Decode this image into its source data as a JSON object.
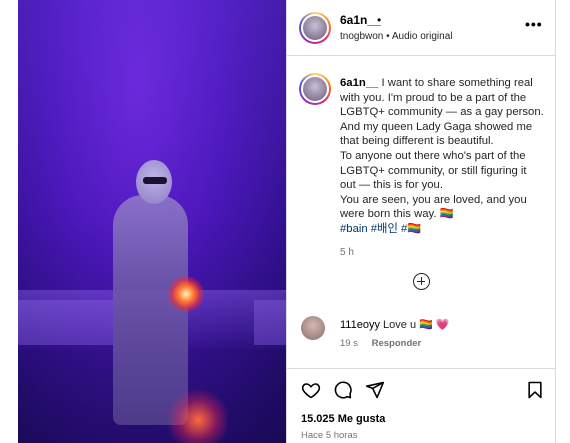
{
  "post": {
    "username": "6a1n__",
    "separator_dot": "•",
    "audio_line": "tnogbwon • Audio original",
    "more_label": "•••",
    "caption_username": "6a1n__",
    "caption_lines": [
      "I want to share something real",
      "with you. I'm proud to be a part of the",
      "LGBTQ+ community — as a gay person.",
      "And my queen Lady Gaga showed me",
      "that being different is beautiful.",
      "To anyone out there who's part of the",
      "LGBTQ+ community, or still figuring it",
      "out — this is for you.",
      "You are seen, you are loved, and you",
      "were born this way. 🏳️‍🌈"
    ],
    "hashtags": "#bain #배인 #🏳️‍🌈",
    "caption_time": "5 h"
  },
  "comment": {
    "username": "111eoyy",
    "text": "Love u 🏳️‍🌈 💗",
    "time": "19 s",
    "reply_label": "Responder"
  },
  "actions": {
    "likes": "15.025 Me gusta",
    "time_ago": "Hace 5 horas"
  }
}
